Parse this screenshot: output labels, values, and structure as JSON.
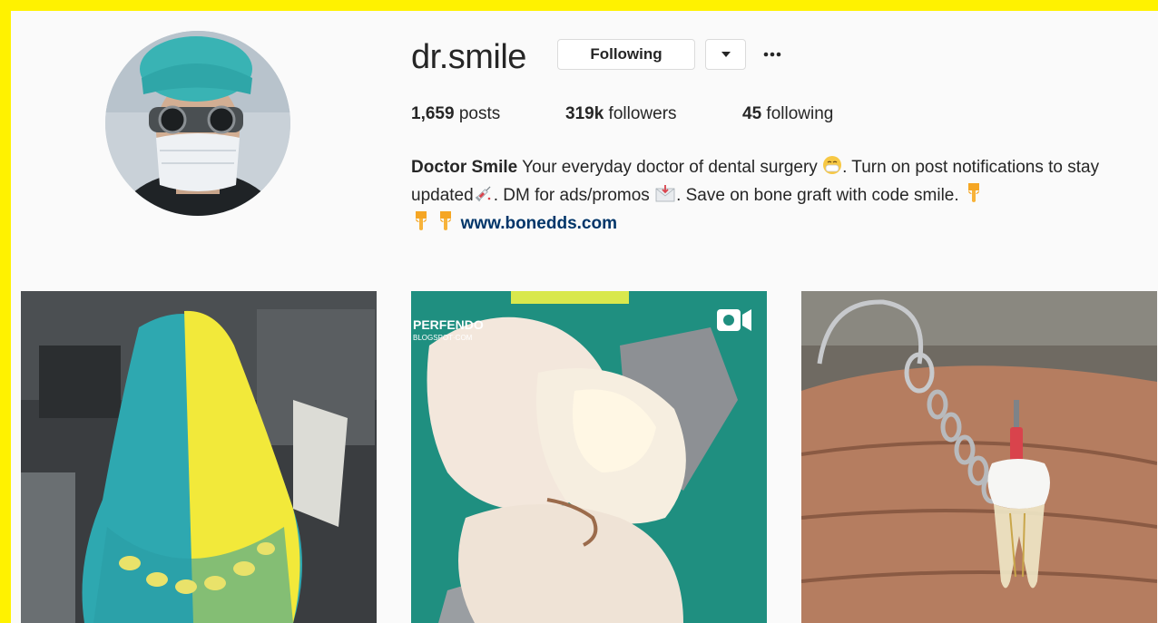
{
  "profile": {
    "username": "dr.smile",
    "following_button": "Following",
    "stats": {
      "posts_count": "1,659",
      "posts_label": " posts",
      "followers_count": "319k",
      "followers_label": " followers",
      "following_count": "45",
      "following_label": " following"
    },
    "bio": {
      "name": "Doctor Smile",
      "text1": " Your everyday doctor of dental surgery ",
      "text2": ". Turn on post notifications to stay updated",
      "text3": ". DM for ads/promos ",
      "text4": ". Save on bone graft with code smile. ",
      "link": "www.bonedds.com"
    }
  },
  "posts": [
    {
      "alt": "impression-photo"
    },
    {
      "alt": "tooth-photo",
      "watermark_line1": "PERFENDO",
      "watermark_line2": "BLOGSPOT·COM"
    },
    {
      "alt": "keychain-tooth-photo"
    }
  ],
  "colors": {
    "border": "#fff200",
    "background": "#fafafa",
    "link": "#003569",
    "text": "#262626"
  },
  "icons": [
    "chevron-down-icon",
    "more-options-icon",
    "mask-face-emoji-icon",
    "syringe-emoji-icon",
    "envelope-emoji-icon",
    "pointing-down-emoji-icon",
    "video-icon"
  ]
}
